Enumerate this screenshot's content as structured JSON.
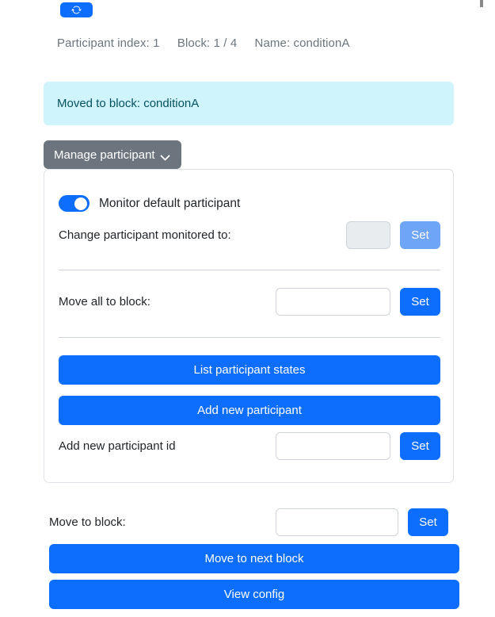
{
  "toolbar": {
    "refresh_icon": "refresh-icon",
    "refresh_label": ""
  },
  "status": {
    "participant_index": "Participant index: 1",
    "block": "Block: 1 / 4",
    "name": "Name: conditionA"
  },
  "alert": {
    "message": "Moved to block: conditionA",
    "bg_color": "#cff4fc",
    "text_color": "#055160"
  },
  "manage": {
    "label": "Manage participant",
    "chevron_icon": "chevron-down-icon",
    "bg_color": "#6c757d"
  },
  "card": {
    "monitor_toggle": {
      "label": "Monitor default participant",
      "checked": true,
      "on_color": "#0d6efd"
    },
    "change_monitored": {
      "label": "Change participant monitored to:",
      "input_value": "",
      "input_placeholder": "",
      "input_disabled": true,
      "set_label": "Set",
      "set_disabled": true
    },
    "move_all": {
      "label": "Move all to block:",
      "input_value": "",
      "input_placeholder": "",
      "set_label": "Set"
    },
    "list_states_label": "List participant states",
    "add_participant_label": "Add new participant",
    "add_participant_id": {
      "label": "Add new participant id",
      "input_value": "",
      "input_placeholder": "",
      "set_label": "Set"
    }
  },
  "bottom": {
    "move_to_block": {
      "label": "Move to block:",
      "input_value": "",
      "input_placeholder": "",
      "set_label": "Set"
    },
    "move_next_label": "Move to next block",
    "view_config_label": "View config"
  },
  "colors": {
    "primary": "#0d6efd",
    "primary_muted": "#6ea5f7",
    "secondary": "#6c757d",
    "border": "#dee2e6",
    "input_disabled_bg": "#e9ecef"
  }
}
